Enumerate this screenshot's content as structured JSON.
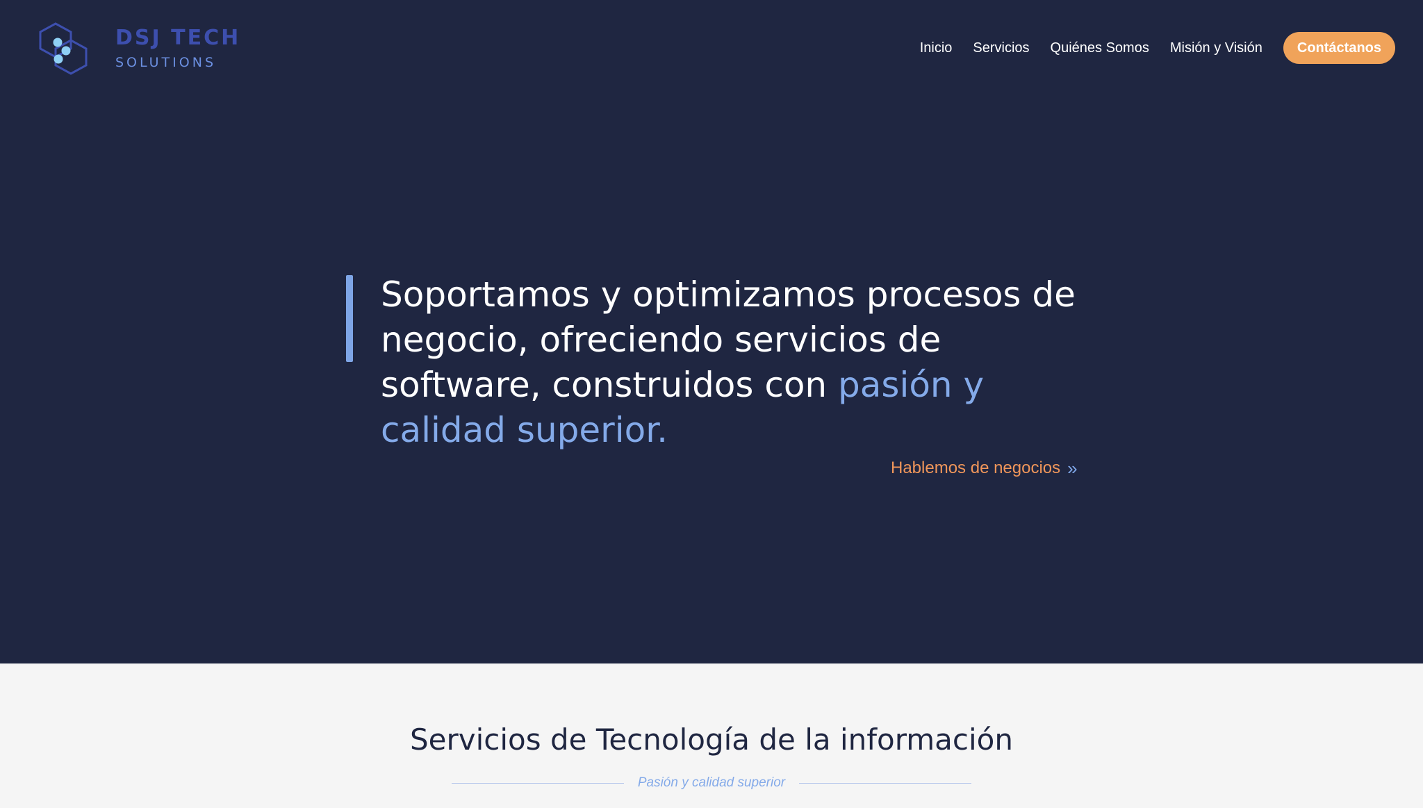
{
  "brand": {
    "name": "DSJ TECH",
    "subtitle": "SOLUTIONS"
  },
  "nav": {
    "items": [
      {
        "label": "Inicio"
      },
      {
        "label": "Servicios"
      },
      {
        "label": "Quiénes Somos"
      },
      {
        "label": "Misión y Visión"
      }
    ],
    "cta_label": "Contáctanos"
  },
  "hero": {
    "heading_prefix": "Soportamos y optimizamos procesos de negocio, ofreciendo servicios de software, construidos con ",
    "heading_accent": "pasión y calidad superior.",
    "cta_label": "Hablemos de negocios",
    "cta_icon": "double-chevron-right-icon"
  },
  "services": {
    "title": "Servicios de Tecnología de la información",
    "tagline": "Pasión y calidad superior"
  },
  "colors": {
    "background": "#1f2641",
    "accent_blue": "#84aae9",
    "accent_orange": "#f0a35a",
    "logo_blue": "#3d4fae",
    "section_light": "#f5f5f5"
  }
}
